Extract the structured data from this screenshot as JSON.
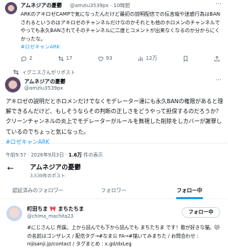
{
  "tweet1": {
    "author": "アムネジアの憂鬱",
    "handle_time": "@amziu3539px · 10時間",
    "body": "ARKのアキロゼCAMPで気になったんだけど最初の説明配信での伝言縦や迷惑行為はBANされるというのはアキロゼのチャンネルだけなのかそれとも他のホロメンのチャンネルでやっても永久BANされてそのチャンネルに二度とコメントが出来なくなるのか分からにくかったな。",
    "hashtag": "#ロゼキャンARK",
    "stats": {
      "replies": "2",
      "reposts": "17",
      "likes": "93",
      "views": "12万"
    }
  },
  "repost_note": "イグニスさんがリポスト",
  "tweet2": {
    "author": "アムネジアの憂鬱",
    "handle": "@amziu3539px",
    "body": "アキロゼの説明だとホロメンだけでなくモデレーター達にも永久BANの権限があると理解できるんだけど、もしそうならその判断の正しさをどうやって担保するのだろうか？クリーンチャンネルの炎上でモデレーターがルールを無視した削除をしカバーが謝罪しているのでちょっと気になった。",
    "hashtag": "#ロゼキャンARK",
    "timestamp": "午前9:57 · 2026年9月3日 · ",
    "views_count": "1.6万",
    "views_label": " 件の表示"
  },
  "profile": {
    "title": "アムネジアの憂鬱",
    "posts": "3,539件のポスト",
    "tabs": [
      "認証済みのフォロワー",
      "フォロワー",
      "フォロー中"
    ],
    "active_tab": 2
  },
  "follow_item": {
    "name": "町田ちま 🎀 まちたちま",
    "handle": "@chima_machita23",
    "follow_label": "フォロー中",
    "bio": "#にじさんじ 所属。上から読んでも下から読んでも まちたちま です！歌が好きな猫。🐱 の名前はゴンザレス / 配信タグ→#なま公 FA→#描いてみまちた / お問合わせ : nijisanji.jp/contact / タグまとめ : x.gd/dxLeg"
  },
  "colors": {
    "accent": "#1d9bf0",
    "muted": "#536471",
    "text": "#0f1419"
  }
}
